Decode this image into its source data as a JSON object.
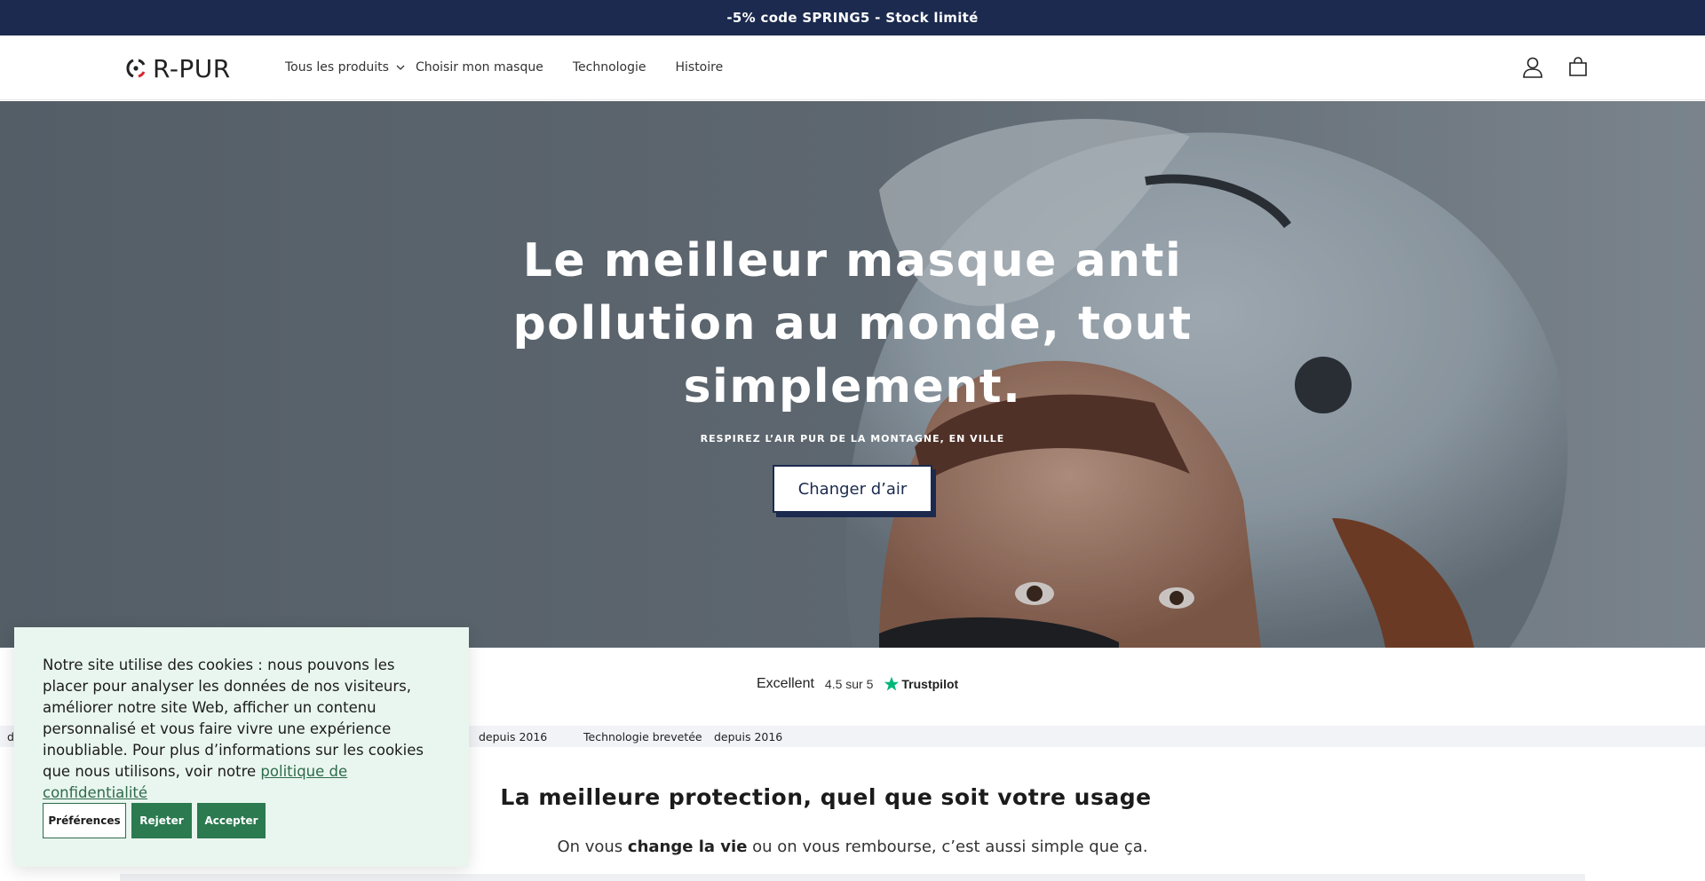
{
  "announcement": {
    "text": "-5% code SPRING5 - Stock limité"
  },
  "header": {
    "logo_text": "R-PUR",
    "nav": [
      {
        "label": "Tous les produits",
        "has_dropdown": true
      },
      {
        "label": "Choisir mon masque"
      },
      {
        "label": "Technologie"
      },
      {
        "label": "Histoire"
      }
    ],
    "icons": [
      "account-icon",
      "cart-icon"
    ]
  },
  "hero": {
    "title": "Le meilleur masque anti pollution au monde, tout simplement.",
    "subtitle": "RESPIREZ L’AIR PUR DE LA MONTAGNE, EN VILLE",
    "button_label": "Changer d’air"
  },
  "trustpilot": {
    "label": "Excellent",
    "score": "4.5 sur 5",
    "brand": "Trustpilot",
    "star_color": "#00b67a"
  },
  "ticker": [
    "d",
    "depuis 2016",
    "Technologie brevetée",
    "depuis 2016"
  ],
  "section": {
    "title": "La meilleure protection, quel que soit votre usage",
    "subtitle_pre": "On vous",
    "subtitle_bold": "change la vie",
    "subtitle_post": "ou on vous rembourse, c’est aussi simple que ça."
  },
  "cookie": {
    "text": "Notre site utilise des cookies : nous pouvons les placer pour analyser les données de nos visiteurs, améliorer notre site Web, afficher un contenu personnalisé et vous faire vivre une expérience inoubliable. Pour plus d’informations sur les cookies que nous utilisons, voir notre",
    "link_text": "politique de confidentialité",
    "buttons": {
      "preferences": "Préférences",
      "reject": "Rejeter",
      "accept": "Accepter"
    },
    "accent_color": "#2b7a50"
  },
  "colors": {
    "navy": "#1b2a4e",
    "logo_red": "#d7262e"
  }
}
